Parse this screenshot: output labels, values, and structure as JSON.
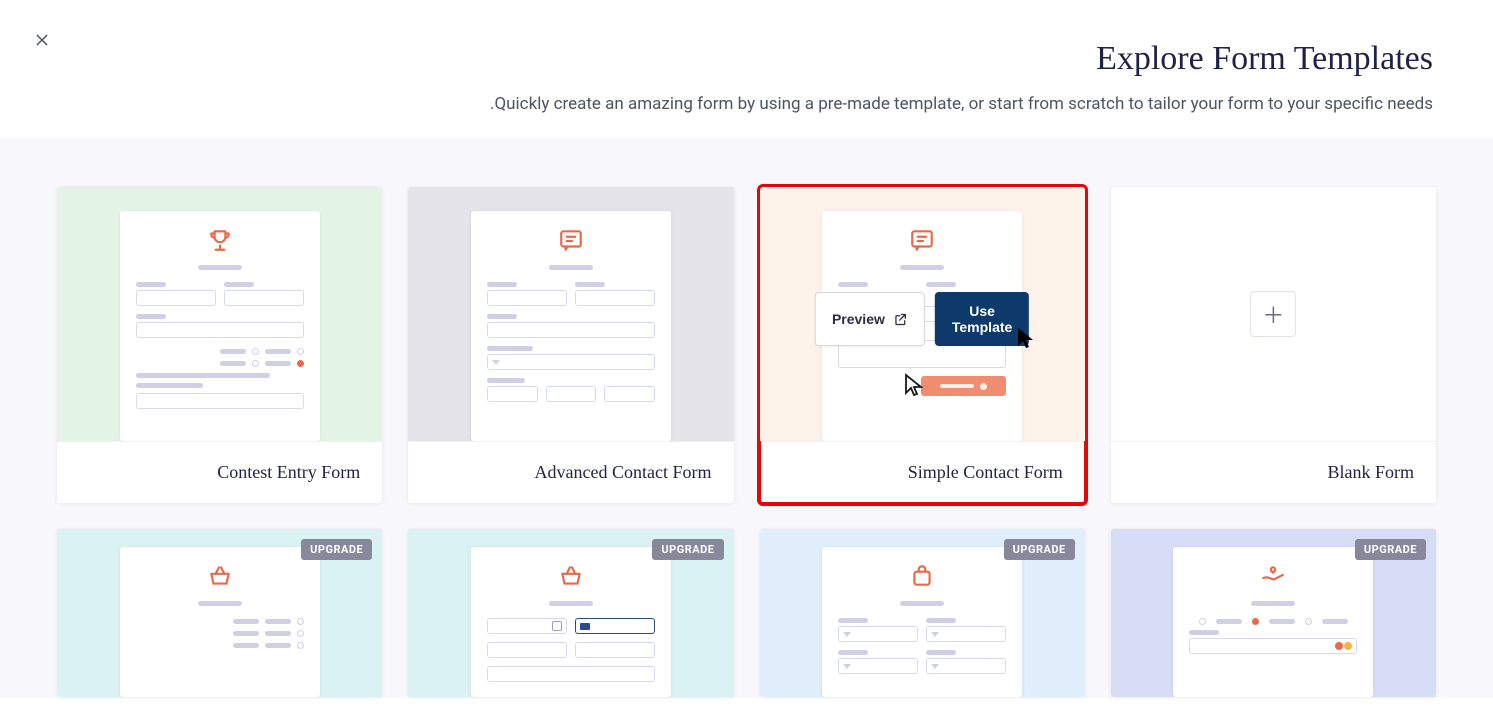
{
  "header": {
    "title": "Explore Form Templates",
    "subtitle": ".Quickly create an amazing form by using a pre-made template, or start from scratch to tailor your form to your specific needs"
  },
  "actions": {
    "preview": "Preview",
    "use_template": "Use Template"
  },
  "badge": {
    "upgrade": "UPGRADE"
  },
  "templates": [
    {
      "label": "Contest Entry Form"
    },
    {
      "label": "Advanced Contact Form"
    },
    {
      "label": "Simple Contact Form"
    },
    {
      "label": "Blank Form"
    }
  ]
}
